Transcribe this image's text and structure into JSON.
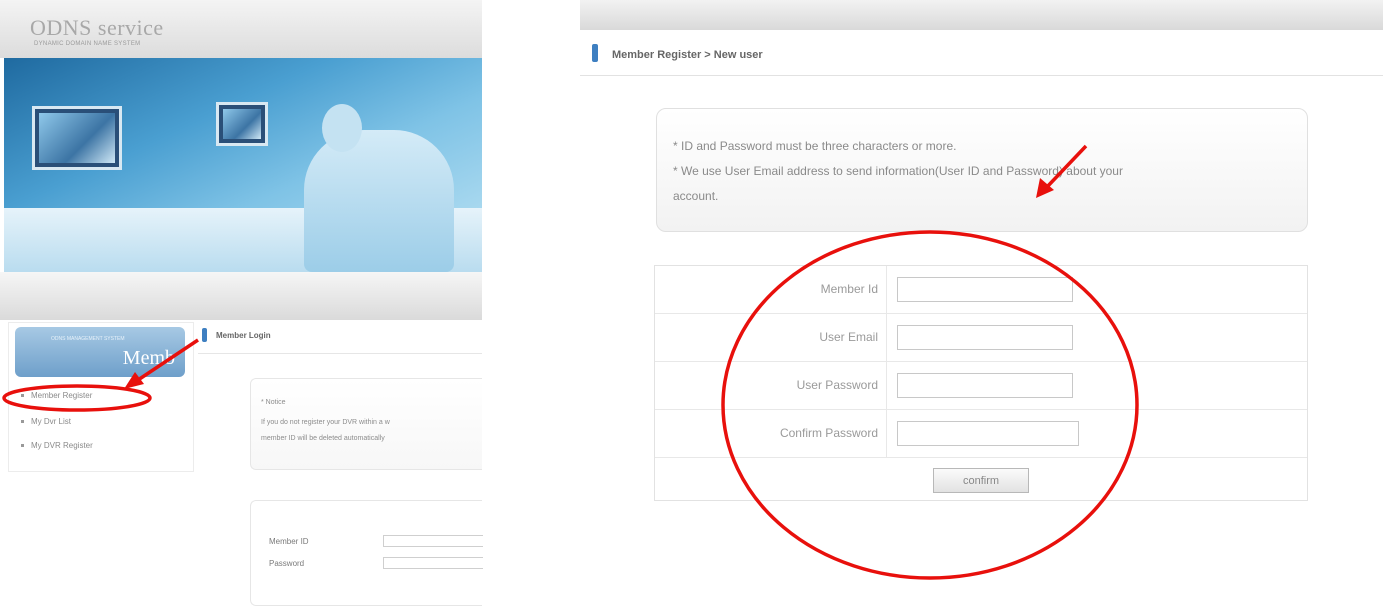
{
  "left_panel": {
    "logo": "ODNS service",
    "logo_subtitle": "DYNAMIC DOMAIN NAME SYSTEM",
    "sidebar": {
      "badge_subtitle": "ODNS MANAGEMENT SYSTEM",
      "badge_text": "Memb",
      "items": [
        {
          "label": "Member Register"
        },
        {
          "label": "My Dvr List"
        },
        {
          "label": "My DVR Register"
        }
      ]
    },
    "section_title": "Member Login",
    "notice": {
      "title": "* Notice",
      "line1": "If you do not register your DVR within a w",
      "line2": "member ID will be deleted automatically"
    },
    "login": {
      "member_id_label": "Member ID",
      "password_label": "Password"
    }
  },
  "right_panel": {
    "breadcrumb": "Member Register > New user",
    "info": {
      "line1": "* ID and Password must be three characters or more.",
      "line2": "* We use User Email address to send information(User ID and Password) about your",
      "line3": "account."
    },
    "form": {
      "fields": [
        {
          "label": "Member Id",
          "value": ""
        },
        {
          "label": "User Email",
          "value": ""
        },
        {
          "label": "User Password",
          "value": ""
        },
        {
          "label": "Confirm Password",
          "value": ""
        }
      ],
      "confirm_label": "confirm"
    }
  },
  "colors": {
    "accent_blue": "#3e7fc1",
    "annotation_red": "#e8100c",
    "badge_blue": "#7faad2"
  },
  "icons": [
    "bullet-icon",
    "section-marker-icon",
    "red-arrow-icon",
    "red-ellipse-highlight"
  ]
}
